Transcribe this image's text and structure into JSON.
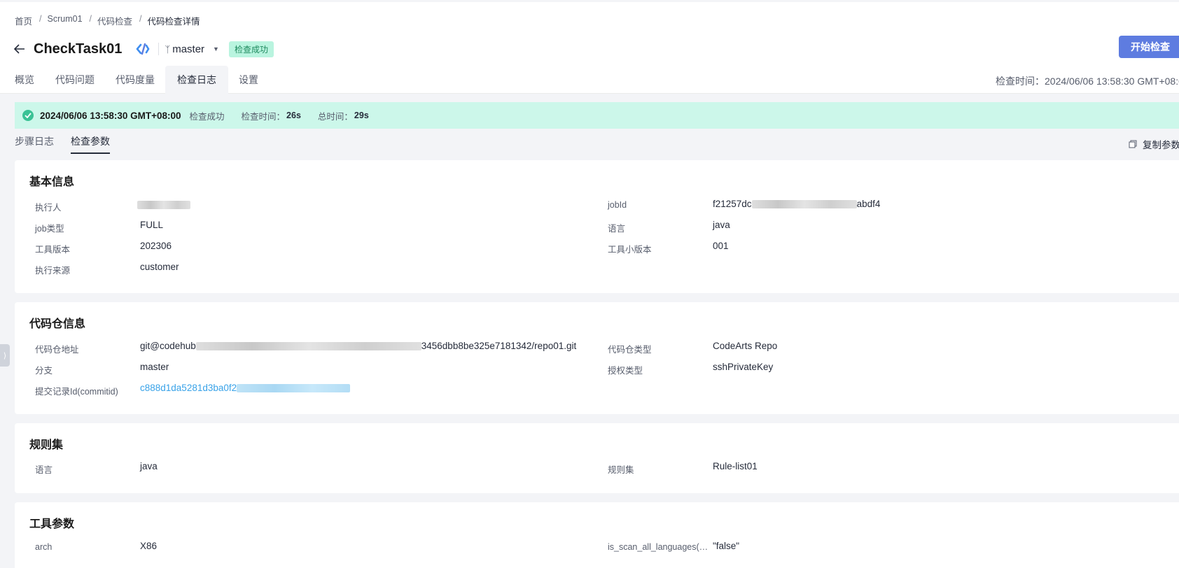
{
  "breadcrumb": [
    "首页",
    "Scrum01",
    "代码检查",
    "代码检查详情"
  ],
  "breadcrumb_sep": "/",
  "task": {
    "title": "CheckTask01",
    "branch": "master",
    "status": "检查成功",
    "start_button": "开始检查"
  },
  "tabs": [
    "概览",
    "代码问题",
    "代码度量",
    "检查日志",
    "设置"
  ],
  "active_tab": "检查日志",
  "check_time": "检查时间：2024/06/06 13:58:30 GMT+08:00",
  "result_bar": {
    "time": "2024/06/06 13:58:30 GMT+08:00",
    "status": "检查成功",
    "check_duration_label": "检查时间：",
    "check_duration": "26s",
    "total_label": "总时间：",
    "total": "29s"
  },
  "subtabs": [
    "步骤日志",
    "检查参数"
  ],
  "active_subtab": "检查参数",
  "copy_params": "复制参数",
  "basic_info": {
    "title": "基本信息",
    "executor_label": "执行人",
    "executor_value": "",
    "job_type_label": "job类型",
    "job_type_value": "FULL",
    "tool_version_label": "工具版本",
    "tool_version_value": "202306",
    "source_label": "执行来源",
    "source_value": "customer",
    "job_id_label": "jobId",
    "job_id_prefix": "f21257dc",
    "job_id_suffix": "abdf4",
    "language_label": "语言",
    "language_value": "java",
    "tool_minor_label": "工具小版本",
    "tool_minor_value": "001"
  },
  "repo_info": {
    "title": "代码仓信息",
    "repo_addr_label": "代码仓地址",
    "repo_addr_prefix": "git@codehub",
    "repo_addr_suffix": "3456dbb8be325e7181342/repo01.git",
    "branch_label": "分支",
    "branch_value": "master",
    "commit_label": "提交记录Id(commitid)",
    "commit_prefix": "c888d1da5281d3ba0f2",
    "repo_type_label": "代码仓类型",
    "repo_type_value": "CodeArts Repo",
    "auth_type_label": "授权类型",
    "auth_type_value": "sshPrivateKey"
  },
  "ruleset": {
    "title": "规则集",
    "language_label": "语言",
    "language_value": "java",
    "ruleset_label": "规则集",
    "ruleset_value": "Rule-list01"
  },
  "tool_params": {
    "title": "工具参数",
    "arch_label": "arch",
    "arch_value": "X86",
    "scan_all_label": "is_scan_all_languages(…",
    "scan_all_value": "\"false\""
  },
  "colors": {
    "primary": "#5e7ce0",
    "success_bg": "#ccf7ea",
    "success_icon": "#3ac295",
    "badge_bg": "#b9f4df",
    "link": "#38a2e8"
  }
}
